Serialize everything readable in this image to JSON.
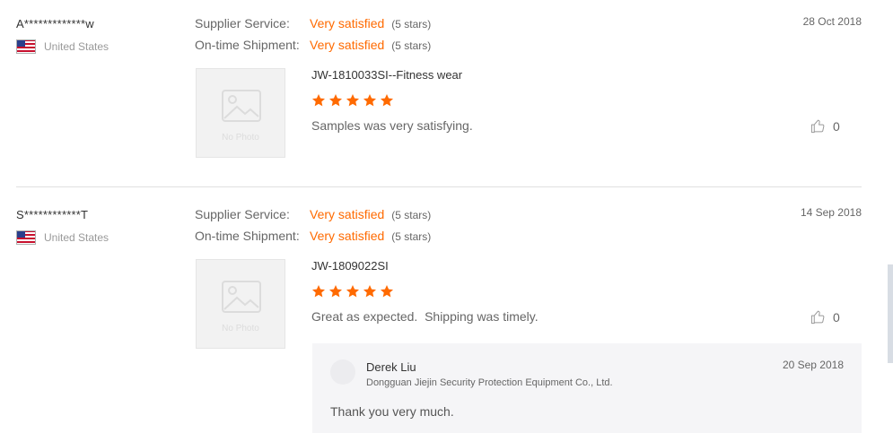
{
  "reviews": [
    {
      "buyer": "A*************w",
      "country": "United States",
      "date": "28 Oct 2018",
      "supplier_service_label": "Supplier Service:",
      "supplier_service_value": "Very satisfied",
      "supplier_service_stars": "(5 stars)",
      "shipment_label": "On-time Shipment:",
      "shipment_value": "Very satisfied",
      "shipment_stars": "(5 stars)",
      "photo_placeholder": "No Photo",
      "product": "JW-1810033SI--Fitness wear",
      "rating": 5,
      "text": "Samples was very satisfying.",
      "likes": "0"
    },
    {
      "buyer": "S************T",
      "country": "United States",
      "date": "14 Sep 2018",
      "supplier_service_label": "Supplier Service:",
      "supplier_service_value": "Very satisfied",
      "supplier_service_stars": "(5 stars)",
      "shipment_label": "On-time Shipment:",
      "shipment_value": "Very satisfied",
      "shipment_stars": "(5 stars)",
      "photo_placeholder": "No Photo",
      "product": "JW-1809022SI",
      "rating": 5,
      "text": "Great as expected.  Shipping was timely.",
      "likes": "0",
      "reply": {
        "name": "Derek Liu",
        "company": "Dongguan Jiejin Security Protection Equipment Co., Ltd.",
        "date": "20 Sep 2018",
        "text": "Thank you very much."
      }
    }
  ],
  "colors": {
    "accent": "#ff6a00",
    "text_primary": "#333333",
    "text_secondary": "#666666",
    "muted": "#999999"
  },
  "icons": {
    "flag": "us-flag-icon",
    "photo": "no-photo-icon",
    "star": "star-icon",
    "like": "thumbs-up-icon"
  }
}
